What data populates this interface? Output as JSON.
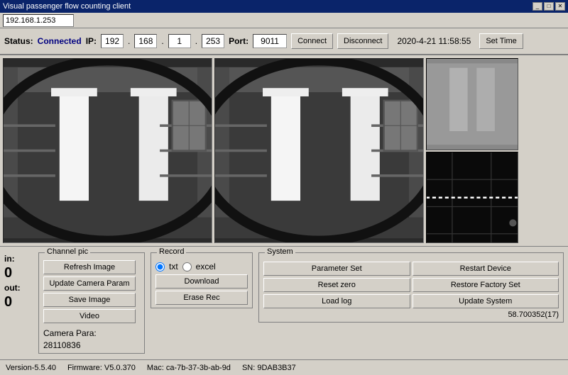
{
  "titleBar": {
    "title": "Visual passenger flow counting client",
    "controls": [
      "_",
      "□",
      "✕"
    ]
  },
  "addressBar": {
    "value": "192.168.1.253"
  },
  "toolbar": {
    "status_label": "Status:",
    "status_value": "Connected",
    "ip_label": "IP:",
    "ip_parts": [
      "192",
      "168",
      "1",
      "253"
    ],
    "port_label": "Port:",
    "port_value": "9011",
    "connect_btn": "Connect",
    "disconnect_btn": "Disconnect",
    "datetime": "2020-4-21  11:58:55",
    "set_time_btn": "Set Time"
  },
  "inOut": {
    "in_label": "in:",
    "in_value": "0",
    "out_label": "out:",
    "out_value": "0"
  },
  "channelPic": {
    "title": "Channel pic",
    "refresh_btn": "Refresh Image",
    "update_btn": "Update Camera Param",
    "save_btn": "Save Image",
    "video_btn": "Video",
    "camera_para_label": "Camera Para:",
    "camera_para_value": "28110836"
  },
  "record": {
    "title": "Record",
    "radio_txt": "txt",
    "radio_excel": "excel",
    "download_btn": "Download",
    "erase_btn": "Erase Rec"
  },
  "system": {
    "title": "System",
    "parameter_set_btn": "Parameter Set",
    "restart_device_btn": "Restart Device",
    "reset_zero_btn": "Reset zero",
    "restore_factory_btn": "Restore Factory Set",
    "load_log_btn": "Load log",
    "update_system_btn": "Update System",
    "version_value": "58.700352(17)"
  },
  "footer": {
    "version_label": "Version-5.5.40",
    "firmware_label": "Firmware: V5.0.370",
    "mac_label": "Mac: ca-7b-37-3b-ab-9d",
    "sn_label": "SN: 9DAB3B37"
  }
}
